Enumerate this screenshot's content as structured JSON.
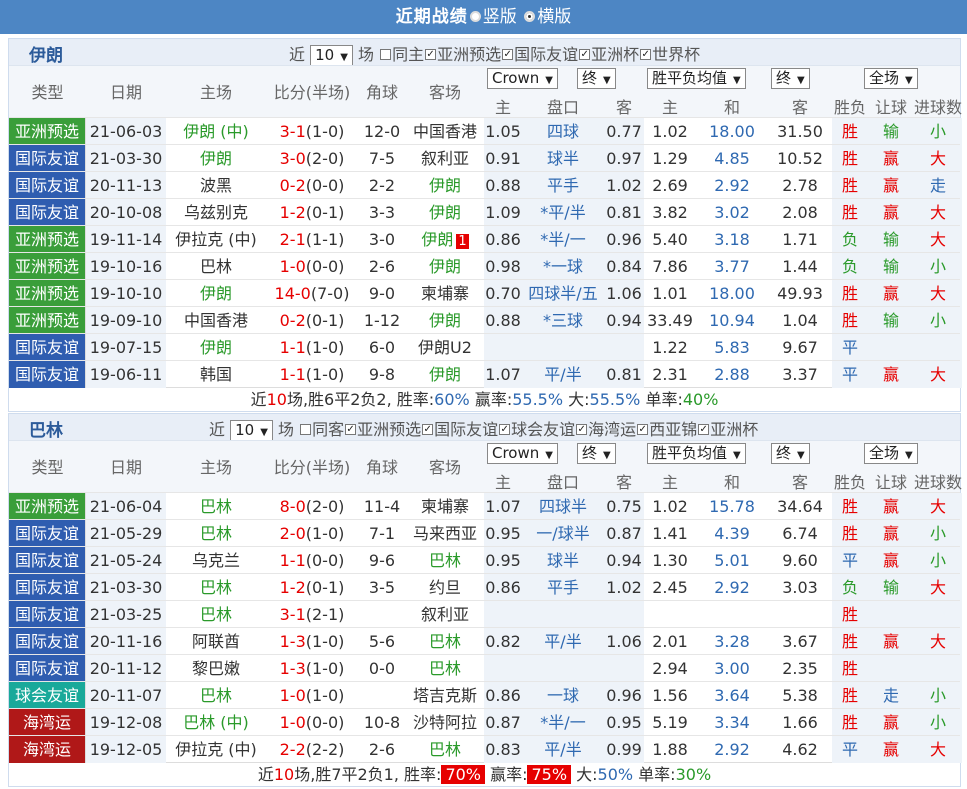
{
  "title_bar": {
    "title": "近期战绩",
    "option_vertical": "竖版",
    "option_horizontal": "横版"
  },
  "colors": {
    "亚洲预选": "#3a9e3a",
    "国际友谊": "#2f5db0",
    "球会友谊": "#19a99a",
    "海湾运": "#b01818"
  },
  "sections": [
    {
      "team": "伊朗",
      "filter": {
        "recent_label": "近",
        "count": "10",
        "unit_label": "场",
        "same_label": "同主",
        "tags": [
          "亚洲预选",
          "国际友谊",
          "亚洲杯",
          "世界杯"
        ],
        "checked": [
          true,
          true,
          true,
          true
        ],
        "same_checked": false
      },
      "header": {
        "type": "类型",
        "date": "日期",
        "home": "主场",
        "score": "比分(半场)",
        "corner": "角球",
        "away": "客场",
        "company": "Crown",
        "end1": "终",
        "win_avg": "胜平负均值",
        "end2": "终",
        "scope": "全场",
        "odds_home": "主",
        "handicap": "盘口",
        "odds_away": "客",
        "w_home": "主",
        "w_draw": "和",
        "w_away": "客",
        "result": "胜负",
        "let": "让球",
        "goals": "进球数"
      },
      "rows": [
        {
          "type": "亚洲预选",
          "date": "21-06-03",
          "home": "伊朗 (中)",
          "score": "3-1",
          "half": "(1-0)",
          "corner": "12-0",
          "away": "中国香港",
          "oh": "1.05",
          "pan": "四球",
          "oa": "0.77",
          "wh": "1.02",
          "wd": "18.00",
          "wa": "31.50",
          "sf": "胜",
          "rq": "输",
          "jq": "小",
          "hi": "home",
          "badge": ""
        },
        {
          "type": "国际友谊",
          "date": "21-03-30",
          "home": "伊朗",
          "score": "3-0",
          "half": "(2-0)",
          "corner": "7-5",
          "away": "叙利亚",
          "oh": "0.91",
          "pan": "球半",
          "oa": "0.97",
          "wh": "1.29",
          "wd": "4.85",
          "wa": "10.52",
          "sf": "胜",
          "rq": "赢",
          "jq": "大",
          "hi": "home",
          "badge": ""
        },
        {
          "type": "国际友谊",
          "date": "20-11-13",
          "home": "波黑",
          "score": "0-2",
          "half": "(0-0)",
          "corner": "2-2",
          "away": "伊朗",
          "oh": "0.88",
          "pan": "平手",
          "oa": "1.02",
          "wh": "2.69",
          "wd": "2.92",
          "wa": "2.78",
          "sf": "胜",
          "rq": "赢",
          "jq": "走",
          "hi": "away",
          "badge": ""
        },
        {
          "type": "国际友谊",
          "date": "20-10-08",
          "home": "乌兹别克",
          "score": "1-2",
          "half": "(0-1)",
          "corner": "3-3",
          "away": "伊朗",
          "oh": "1.09",
          "pan": "*平/半",
          "oa": "0.81",
          "wh": "3.82",
          "wd": "3.02",
          "wa": "2.08",
          "sf": "胜",
          "rq": "赢",
          "jq": "大",
          "hi": "away",
          "badge": ""
        },
        {
          "type": "亚洲预选",
          "date": "19-11-14",
          "home": "伊拉克 (中)",
          "score": "2-1",
          "half": "(1-1)",
          "corner": "3-0",
          "away": "伊朗",
          "oh": "0.86",
          "pan": "*半/一",
          "oa": "0.96",
          "wh": "5.40",
          "wd": "3.18",
          "wa": "1.71",
          "sf": "负",
          "rq": "输",
          "jq": "大",
          "hi": "away",
          "badge": "1"
        },
        {
          "type": "亚洲预选",
          "date": "19-10-16",
          "home": "巴林",
          "score": "1-0",
          "half": "(0-0)",
          "corner": "2-6",
          "away": "伊朗",
          "oh": "0.98",
          "pan": "*一球",
          "oa": "0.84",
          "wh": "7.86",
          "wd": "3.77",
          "wa": "1.44",
          "sf": "负",
          "rq": "输",
          "jq": "小",
          "hi": "away",
          "badge": ""
        },
        {
          "type": "亚洲预选",
          "date": "19-10-10",
          "home": "伊朗",
          "score": "14-0",
          "half": "(7-0)",
          "corner": "9-0",
          "away": "柬埔寨",
          "oh": "0.70",
          "pan": "四球半/五",
          "oa": "1.06",
          "wh": "1.01",
          "wd": "18.00",
          "wa": "49.93",
          "sf": "胜",
          "rq": "赢",
          "jq": "大",
          "hi": "home",
          "badge": ""
        },
        {
          "type": "亚洲预选",
          "date": "19-09-10",
          "home": "中国香港",
          "score": "0-2",
          "half": "(0-1)",
          "corner": "1-12",
          "away": "伊朗",
          "oh": "0.88",
          "pan": "*三球",
          "oa": "0.94",
          "wh": "33.49",
          "wd": "10.94",
          "wa": "1.04",
          "sf": "胜",
          "rq": "输",
          "jq": "小",
          "hi": "away",
          "badge": ""
        },
        {
          "type": "国际友谊",
          "date": "19-07-15",
          "home": "伊朗",
          "score": "1-1",
          "half": "(1-0)",
          "corner": "6-0",
          "away": "伊朗U2",
          "oh": "",
          "pan": "",
          "oa": "",
          "wh": "1.22",
          "wd": "5.83",
          "wa": "9.67",
          "sf": "平",
          "rq": "",
          "jq": "",
          "hi": "home",
          "badge": ""
        },
        {
          "type": "国际友谊",
          "date": "19-06-11",
          "home": "韩国",
          "score": "1-1",
          "half": "(1-0)",
          "corner": "9-8",
          "away": "伊朗",
          "oh": "1.07",
          "pan": "平/半",
          "oa": "0.81",
          "wh": "2.31",
          "wd": "2.88",
          "wa": "3.37",
          "sf": "平",
          "rq": "赢",
          "jq": "大",
          "hi": "away",
          "badge": ""
        }
      ],
      "summary": {
        "p1": "近",
        "n": "10",
        "p2": "场,胜6平2负2, 胜率:",
        "win": "60%",
        "p3": " 赢率:",
        "ying": "55.5%",
        "p4": " 大:",
        "da": "55.5%",
        "p5": " 单率:",
        "dan": "40%"
      }
    },
    {
      "team": "巴林",
      "filter": {
        "recent_label": "近",
        "count": "10",
        "unit_label": "场",
        "same_label": "同客",
        "tags": [
          "亚洲预选",
          "国际友谊",
          "球会友谊",
          "海湾运",
          "西亚锦",
          "亚洲杯"
        ],
        "checked": [
          true,
          true,
          true,
          true,
          true,
          true
        ],
        "same_checked": false
      },
      "header": {
        "type": "类型",
        "date": "日期",
        "home": "主场",
        "score": "比分(半场)",
        "corner": "角球",
        "away": "客场",
        "company": "Crown",
        "end1": "终",
        "win_avg": "胜平负均值",
        "end2": "终",
        "scope": "全场",
        "odds_home": "主",
        "handicap": "盘口",
        "odds_away": "客",
        "w_home": "主",
        "w_draw": "和",
        "w_away": "客",
        "result": "胜负",
        "let": "让球",
        "goals": "进球数"
      },
      "rows": [
        {
          "type": "亚洲预选",
          "date": "21-06-04",
          "home": "巴林",
          "score": "8-0",
          "half": "(2-0)",
          "corner": "11-4",
          "away": "柬埔寨",
          "oh": "1.07",
          "pan": "四球半",
          "oa": "0.75",
          "wh": "1.02",
          "wd": "15.78",
          "wa": "34.64",
          "sf": "胜",
          "rq": "赢",
          "jq": "大",
          "hi": "home",
          "badge": ""
        },
        {
          "type": "国际友谊",
          "date": "21-05-29",
          "home": "巴林",
          "score": "2-0",
          "half": "(1-0)",
          "corner": "7-1",
          "away": "马来西亚",
          "oh": "0.95",
          "pan": "一/球半",
          "oa": "0.87",
          "wh": "1.41",
          "wd": "4.39",
          "wa": "6.74",
          "sf": "胜",
          "rq": "赢",
          "jq": "小",
          "hi": "home",
          "badge": ""
        },
        {
          "type": "国际友谊",
          "date": "21-05-24",
          "home": "乌克兰",
          "score": "1-1",
          "half": "(0-0)",
          "corner": "9-6",
          "away": "巴林",
          "oh": "0.95",
          "pan": "球半",
          "oa": "0.94",
          "wh": "1.30",
          "wd": "5.01",
          "wa": "9.60",
          "sf": "平",
          "rq": "赢",
          "jq": "小",
          "hi": "away",
          "badge": ""
        },
        {
          "type": "国际友谊",
          "date": "21-03-30",
          "home": "巴林",
          "score": "1-2",
          "half": "(0-1)",
          "corner": "3-5",
          "away": "约旦",
          "oh": "0.86",
          "pan": "平手",
          "oa": "1.02",
          "wh": "2.45",
          "wd": "2.92",
          "wa": "3.03",
          "sf": "负",
          "rq": "输",
          "jq": "大",
          "hi": "home",
          "badge": ""
        },
        {
          "type": "国际友谊",
          "date": "21-03-25",
          "home": "巴林",
          "score": "3-1",
          "half": "(2-1)",
          "corner": "",
          "away": "叙利亚",
          "oh": "",
          "pan": "",
          "oa": "",
          "wh": "",
          "wd": "",
          "wa": "",
          "sf": "胜",
          "rq": "",
          "jq": "",
          "hi": "home",
          "badge": ""
        },
        {
          "type": "国际友谊",
          "date": "20-11-16",
          "home": "阿联酋",
          "score": "1-3",
          "half": "(1-0)",
          "corner": "5-6",
          "away": "巴林",
          "oh": "0.82",
          "pan": "平/半",
          "oa": "1.06",
          "wh": "2.01",
          "wd": "3.28",
          "wa": "3.67",
          "sf": "胜",
          "rq": "赢",
          "jq": "大",
          "hi": "away",
          "badge": ""
        },
        {
          "type": "国际友谊",
          "date": "20-11-12",
          "home": "黎巴嫩",
          "score": "1-3",
          "half": "(1-0)",
          "corner": "0-0",
          "away": "巴林",
          "oh": "",
          "pan": "",
          "oa": "",
          "wh": "2.94",
          "wd": "3.00",
          "wa": "2.35",
          "sf": "胜",
          "rq": "",
          "jq": "",
          "hi": "away",
          "badge": ""
        },
        {
          "type": "球会友谊",
          "date": "20-11-07",
          "home": "巴林",
          "score": "1-0",
          "half": "(1-0)",
          "corner": "",
          "away": "塔吉克斯",
          "oh": "0.86",
          "pan": "一球",
          "oa": "0.96",
          "wh": "1.56",
          "wd": "3.64",
          "wa": "5.38",
          "sf": "胜",
          "rq": "走",
          "jq": "小",
          "hi": "home",
          "badge": ""
        },
        {
          "type": "海湾运",
          "date": "19-12-08",
          "home": "巴林 (中)",
          "score": "1-0",
          "half": "(0-0)",
          "corner": "10-8",
          "away": "沙特阿拉",
          "oh": "0.87",
          "pan": "*半/一",
          "oa": "0.95",
          "wh": "5.19",
          "wd": "3.34",
          "wa": "1.66",
          "sf": "胜",
          "rq": "赢",
          "jq": "小",
          "hi": "home",
          "badge": ""
        },
        {
          "type": "海湾运",
          "date": "19-12-05",
          "home": "伊拉克 (中)",
          "score": "2-2",
          "half": "(2-2)",
          "corner": "2-6",
          "away": "巴林",
          "oh": "0.83",
          "pan": "平/半",
          "oa": "0.99",
          "wh": "1.88",
          "wd": "2.92",
          "wa": "4.62",
          "sf": "平",
          "rq": "赢",
          "jq": "大",
          "hi": "away",
          "badge": ""
        }
      ],
      "summary": {
        "p1": "近",
        "n": "10",
        "p2": "场,胜7平2负1, 胜率:",
        "win": "70%",
        "p3": " 赢率:",
        "ying": "75%",
        "p4": " 大:",
        "da": "50%",
        "p5": " 单率:",
        "dan": "30%"
      }
    }
  ]
}
